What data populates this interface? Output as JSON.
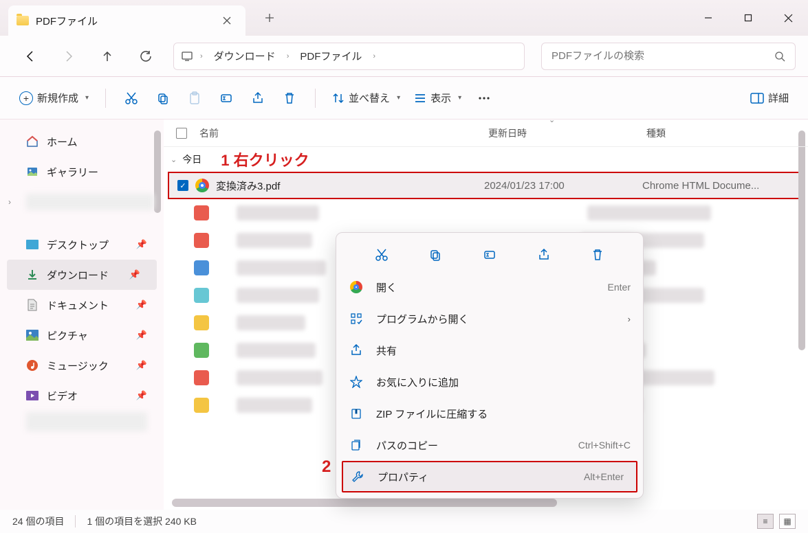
{
  "tab": {
    "title": "PDFファイル"
  },
  "breadcrumb": {
    "seg1": "ダウンロード",
    "seg2": "PDFファイル"
  },
  "search": {
    "placeholder": "PDFファイルの検索"
  },
  "toolbar": {
    "new": "新規作成",
    "sort": "並べ替え",
    "view": "表示",
    "details": "詳細"
  },
  "sidebar": {
    "home": "ホーム",
    "gallery": "ギャラリー",
    "desktop": "デスクトップ",
    "downloads": "ダウンロード",
    "documents": "ドキュメント",
    "pictures": "ピクチャ",
    "music": "ミュージック",
    "videos": "ビデオ"
  },
  "columns": {
    "name": "名前",
    "date": "更新日時",
    "type": "種類"
  },
  "group": {
    "today": "今日"
  },
  "file": {
    "name": "変換済み3.pdf",
    "date": "2024/01/23 17:00",
    "type": "Chrome HTML Docume..."
  },
  "callouts": {
    "c1": "1 右クリック",
    "c2": "2"
  },
  "ctx": {
    "open": "開く",
    "open_shortcut": "Enter",
    "openwith": "プログラムから開く",
    "share": "共有",
    "favorite": "お気に入りに追加",
    "zip": "ZIP ファイルに圧縮する",
    "copypath": "パスのコピー",
    "copypath_shortcut": "Ctrl+Shift+C",
    "properties": "プロパティ",
    "properties_shortcut": "Alt+Enter"
  },
  "status": {
    "count": "24 個の項目",
    "selection": "1 個の項目を選択 240 KB"
  }
}
